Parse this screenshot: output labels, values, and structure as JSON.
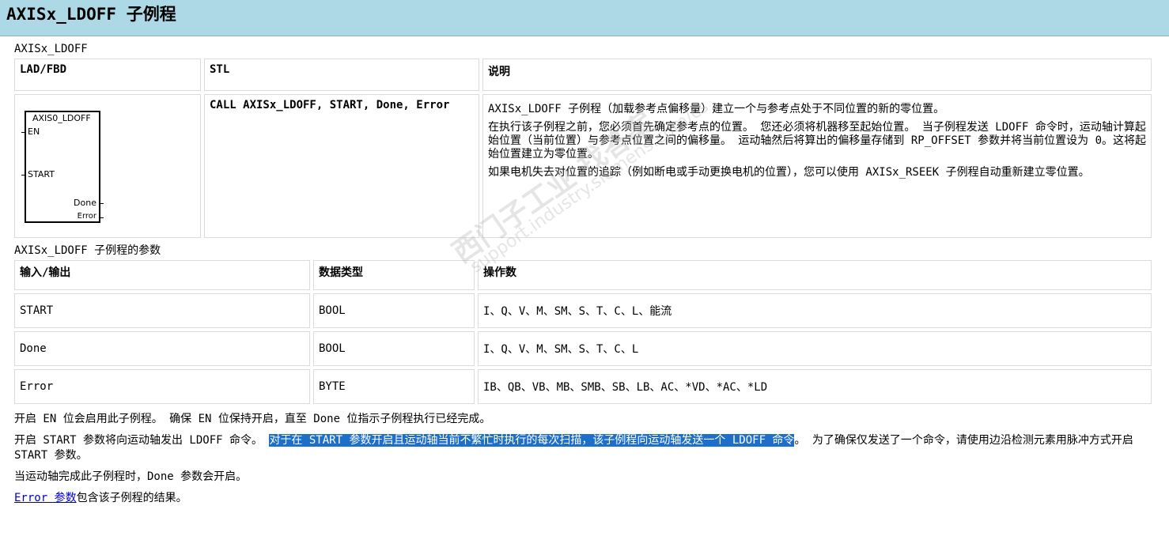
{
  "title": "AXISx_LDOFF 子例程",
  "section1": {
    "label": "AXISx_LDOFF",
    "headers": [
      "LAD/FBD",
      "STL",
      "说明"
    ],
    "lad": {
      "block_name": "AXIS0_LDOFF",
      "pins_left": [
        "EN",
        "START"
      ],
      "pins_right": [
        "Done",
        "Error"
      ]
    },
    "stl_code": "CALL AXISx_LDOFF, START, Done, Error",
    "description": [
      "AXISx_LDOFF 子例程（加载参考点偏移量）建立一个与参考点处于不同位置的新的零位置。",
      "在执行该子例程之前，您必须首先确定参考点的位置。 您还必须将机器移至起始位置。 当子例程发送 LDOFF 命令时，运动轴计算起始位置（当前位置）与参考点位置之间的偏移量。 运动轴然后将算出的偏移量存储到 RP_OFFSET 参数并将当前位置设为 0。这将起始位置建立为零位置。",
      "如果电机失去对位置的追踪（例如断电或手动更换电机的位置），您可以使用 AXISx_RSEEK 子例程自动重新建立零位置。"
    ]
  },
  "section2": {
    "label": "AXISx_LDOFF 子例程的参数",
    "headers": [
      "输入/输出",
      "数据类型",
      "操作数"
    ],
    "rows": [
      [
        "START",
        "BOOL",
        "I、Q、V、M、SM、S、T、C、L、能流"
      ],
      [
        "Done",
        "BOOL",
        "I、Q、V、M、SM、S、T、C、L"
      ],
      [
        "Error",
        "BYTE",
        "IB、QB、VB、MB、SMB、SB、LB、AC、*VD、*AC、*LD"
      ]
    ]
  },
  "notes": {
    "p1": "开启 EN 位会启用此子例程。 确保 EN 位保持开启，直至 Done 位指示子例程执行已经完成。",
    "p2_before": "开启 START 参数将向运动轴发出 LDOFF 命令。 ",
    "p2_highlight": "对于在 START 参数开启且运动轴当前不繁忙时执行的每次扫描，该子例程向运动轴发送一个 LDOFF 命令",
    "p2_after": "。 为了确保仅发送了一个命令，请使用边沿检测元素用脉冲方式开启 START 参数。",
    "p3": "当运动轴完成此子例程时，Done 参数会开启。",
    "p4_link": "Error 参数",
    "p4_text": "包含该子例程的结果。"
  },
  "watermark": {
    "line1": "西门子工业 找答案",
    "line2": "support.industry.siemens.com/cs"
  }
}
